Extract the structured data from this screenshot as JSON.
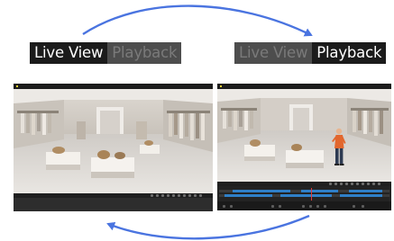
{
  "toggle_left": {
    "live_label": "Live View",
    "playback_label": "Playback",
    "active": "live"
  },
  "toggle_right": {
    "live_label": "Live View",
    "playback_label": "Playback",
    "active": "playback"
  },
  "colors": {
    "arrow": "#4a74e0",
    "active_bg": "#1b1b1b",
    "inactive_bg": "#4d4d4d",
    "record": "#2f7fc7",
    "playhead": "#e03a3a"
  },
  "icons": [
    "curved-arrow-right-icon",
    "curved-arrow-left-icon",
    "window-controls-icon",
    "playback-control-icons"
  ],
  "windows": {
    "live": {
      "mode": "live",
      "content": "store-camera-feed"
    },
    "playback": {
      "mode": "playback",
      "content": "store-camera-feed-with-person"
    }
  }
}
